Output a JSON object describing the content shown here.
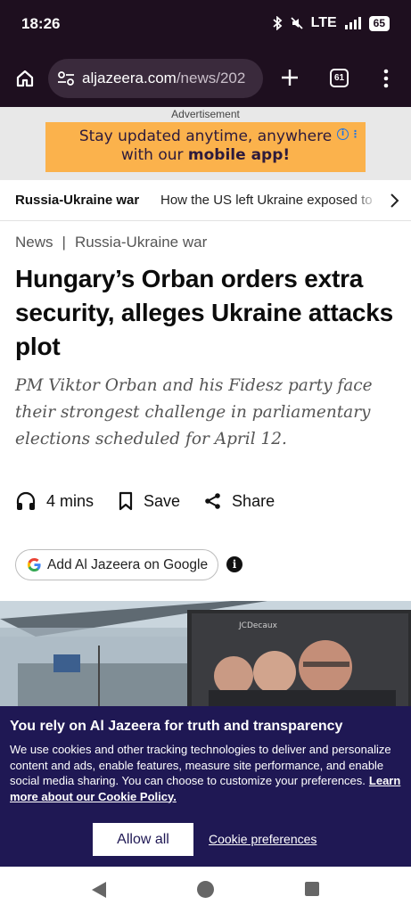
{
  "status": {
    "time": "18:26",
    "network": "LTE",
    "battery": "65"
  },
  "browser": {
    "url_domain": "aljazeera.com",
    "url_path": "/news/202",
    "tab_count": "61"
  },
  "ad": {
    "label": "Advertisement",
    "line1": "Stay updated anytime, anywhere",
    "line2_prefix": "with our ",
    "line2_bold": "mobile app!"
  },
  "topic_bar": {
    "main": "Russia-Ukraine war",
    "link": "How the US left Ukraine exposed to"
  },
  "article": {
    "breadcrumb_section": "News",
    "breadcrumb_separator": "|",
    "breadcrumb_topic": "Russia-Ukraine war",
    "headline": "Hungary’s Orban orders extra security, alleges Ukraine attacks plot",
    "standfirst": "PM Viktor Orban and his Fidesz party face their strongest challenge in parliamentary elections scheduled for April 12.",
    "listen_duration": "4 mins",
    "save_label": "Save",
    "share_label": "Share",
    "google_button": "Add Al Jazeera on Google",
    "info_icon_glyph": "i",
    "image_sign_text": "JCDecaux"
  },
  "cookie": {
    "title": "You rely on Al Jazeera for truth and transparency",
    "body": "We use cookies and other tracking technologies to deliver and personalize content and ads, enable features, measure site performance, and enable social media sharing. You can choose to customize your preferences.",
    "policy_link": "Learn more about our Cookie Policy.",
    "allow_all": "Allow all",
    "preferences": "Cookie preferences"
  },
  "colors": {
    "browser_bg": "#1e0f1f",
    "ad_banner": "#fbb24c",
    "cookie_bg": "#1f1854"
  },
  "icons": [
    "bluetooth-icon",
    "mute-icon",
    "signal-icon",
    "battery-icon",
    "home-icon",
    "site-settings-icon",
    "new-tab-icon",
    "tab-switcher-icon",
    "menu-icon",
    "chevron-right-icon",
    "headphones-icon",
    "bookmark-icon",
    "share-icon",
    "google-icon",
    "info-icon",
    "back-icon",
    "home-nav-icon",
    "recents-icon"
  ]
}
